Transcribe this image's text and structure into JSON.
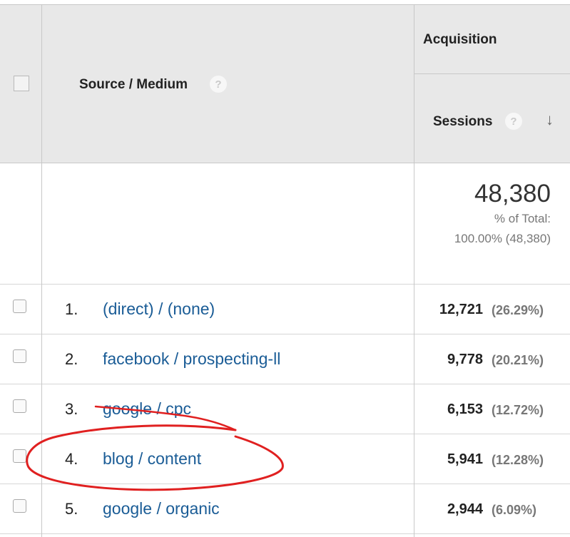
{
  "header": {
    "acquisition_label": "Acquisition",
    "dimension_label": "Source / Medium",
    "dimension_help_icon": "?",
    "metric_label": "Sessions",
    "metric_help_icon": "?",
    "sort_arrow": "↓"
  },
  "totals": {
    "value": "48,380",
    "pct_label": "% of Total:",
    "pct_value": "100.00% (48,380)"
  },
  "rows": [
    {
      "num": "1.",
      "source": "(direct) / (none)",
      "value": "12,721",
      "pct": "(26.29%)"
    },
    {
      "num": "2.",
      "source": "facebook / prospecting-ll",
      "value": "9,778",
      "pct": "(20.21%)"
    },
    {
      "num": "3.",
      "source": "google / cpc",
      "value": "6,153",
      "pct": "(12.72%)"
    },
    {
      "num": "4.",
      "source": "blog / content",
      "value": "5,941",
      "pct": "(12.28%)"
    },
    {
      "num": "5.",
      "source": "google / organic",
      "value": "2,944",
      "pct": "(6.09%)"
    }
  ],
  "annotations": {
    "strike_color": "#e02020",
    "circle_color": "#e02020"
  }
}
